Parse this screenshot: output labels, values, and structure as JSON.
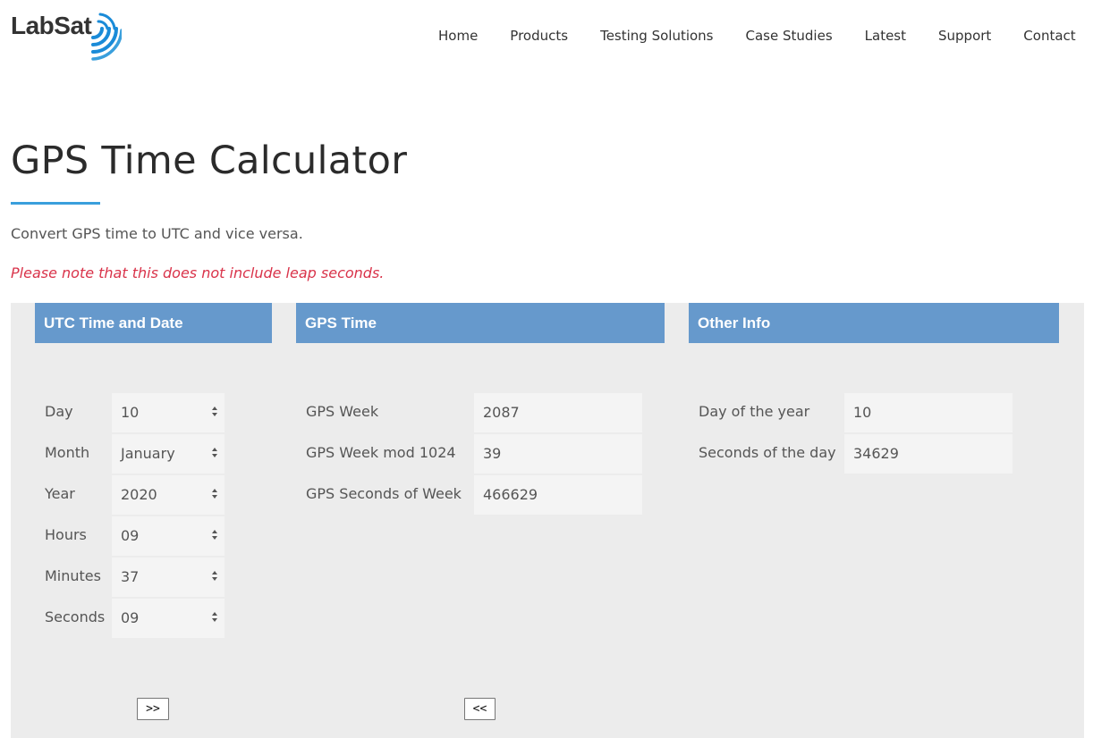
{
  "brand": {
    "logo_text": "LabSat",
    "accent": "#1a8bd8"
  },
  "nav": {
    "items": [
      "Home",
      "Products",
      "Testing Solutions",
      "Case Studies",
      "Latest",
      "Support",
      "Contact"
    ]
  },
  "page": {
    "title": "GPS Time Calculator",
    "intro": "Convert GPS time to UTC and vice versa.",
    "note": "Please note that this does not include leap seconds."
  },
  "utc": {
    "header": "UTC Time and Date",
    "fields": [
      {
        "label": "Day",
        "value": "10"
      },
      {
        "label": "Month",
        "value": "January"
      },
      {
        "label": "Year",
        "value": "2020"
      },
      {
        "label": "Hours",
        "value": "09"
      },
      {
        "label": "Minutes",
        "value": "37"
      },
      {
        "label": "Seconds",
        "value": "09"
      }
    ],
    "to_gps_label": ">>"
  },
  "gps": {
    "header": "GPS Time",
    "fields": [
      {
        "label": "GPS Week",
        "value": "2087"
      },
      {
        "label": "GPS Week mod 1024",
        "value": "39"
      },
      {
        "label": "GPS Seconds of Week",
        "value": "466629"
      }
    ],
    "to_utc_label": "<<"
  },
  "other": {
    "header": "Other Info",
    "fields": [
      {
        "label": "Day of the year",
        "value": "10"
      },
      {
        "label": "Seconds of the day",
        "value": "34629"
      }
    ]
  },
  "colors": {
    "header_bg": "#6699cc",
    "panel_bg": "#ececec",
    "note": "#d9334a",
    "underline": "#3a9fdc"
  }
}
